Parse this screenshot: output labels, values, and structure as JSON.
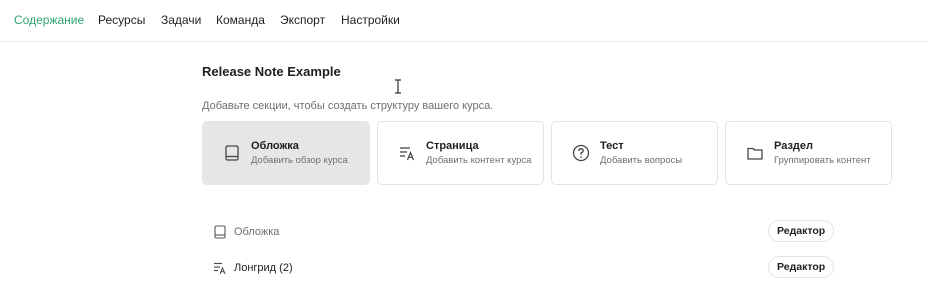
{
  "nav": {
    "items": [
      {
        "label": "Содержание",
        "active": true
      },
      {
        "label": "Ресурсы"
      },
      {
        "label": "Задачи"
      },
      {
        "label": "Команда"
      },
      {
        "label": "Экспорт"
      },
      {
        "label": "Настройки"
      }
    ]
  },
  "course": {
    "title": "Release Note Example",
    "hint": "Добавьте секции, чтобы создать структуру вашего курса."
  },
  "cards": [
    {
      "title": "Обложка",
      "subtitle": "Добавить обзор курса",
      "icon": "book-icon",
      "selected": true
    },
    {
      "title": "Страница",
      "subtitle": "Добавить контент курса",
      "icon": "text-page-icon"
    },
    {
      "title": "Тест",
      "subtitle": "Добавить вопросы",
      "icon": "question-icon"
    },
    {
      "title": "Раздел",
      "subtitle": "Группировать контент",
      "icon": "folder-icon"
    }
  ],
  "sections": [
    {
      "label": "Обложка",
      "icon": "book-icon",
      "action": "Редактор"
    },
    {
      "label": "Лонгрид (2)",
      "icon": "text-page-icon",
      "action": "Редактор"
    }
  ],
  "colors": {
    "accent": "#2fa36b",
    "selected_card": "#e6e6e6"
  }
}
